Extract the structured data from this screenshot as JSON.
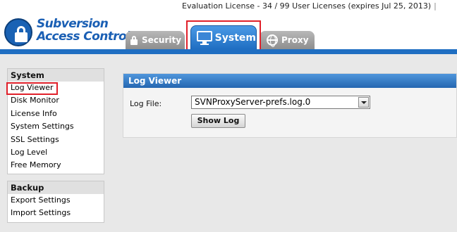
{
  "header": {
    "license_text": "Evaluation License - 34 / 99 User Licenses (expires Jul 25, 2013)",
    "separator": "|",
    "logo_line1": "Subversion",
    "logo_line2": "Access Control"
  },
  "tabs": [
    {
      "label": "Security",
      "icon": "lock-icon",
      "active": false
    },
    {
      "label": "System",
      "icon": "monitor-icon",
      "active": true
    },
    {
      "label": "Proxy",
      "icon": "globe-icon",
      "active": false
    }
  ],
  "sidebar": {
    "system": {
      "title": "System",
      "items": [
        {
          "label": "Log Viewer"
        },
        {
          "label": "Disk Monitor"
        },
        {
          "label": "License Info"
        },
        {
          "label": "System Settings"
        },
        {
          "label": "SSL Settings"
        },
        {
          "label": "Log Level"
        },
        {
          "label": "Free Memory"
        }
      ]
    },
    "backup": {
      "title": "Backup",
      "items": [
        {
          "label": "Export Settings"
        },
        {
          "label": "Import Settings"
        }
      ]
    }
  },
  "main": {
    "panel_title": "Log Viewer",
    "log_file_label": "Log File:",
    "log_file_value": "SVNProxyServer-prefs.log.0",
    "show_log_button": "Show Log"
  },
  "colors": {
    "accent": "#1f6ec2",
    "highlight": "#e0202a",
    "inactive_tab": "#9e9e9e"
  }
}
